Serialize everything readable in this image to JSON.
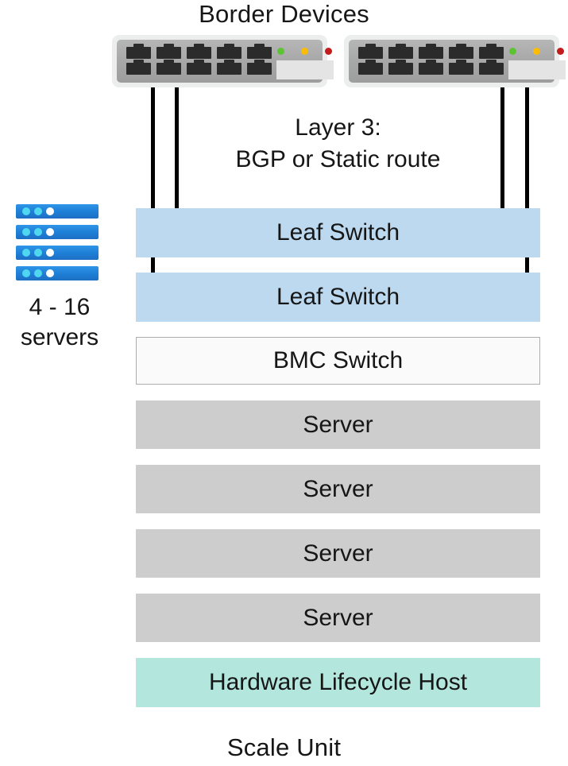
{
  "title": "Border Devices",
  "bottom_label": "Scale Unit",
  "layer3_note": {
    "line1": "Layer 3:",
    "line2": "BGP or Static route"
  },
  "border_devices": [
    {
      "name": "border-device-1",
      "port_count": 10,
      "leds": [
        "green",
        "amber",
        "red"
      ]
    },
    {
      "name": "border-device-2",
      "port_count": 10,
      "leds": [
        "green",
        "amber",
        "red"
      ]
    }
  ],
  "server_stack": {
    "bar_count": 4,
    "count_line1": "4 - 16",
    "count_line2": "servers"
  },
  "rack_rows": [
    {
      "label": "Leaf Switch",
      "kind": "leaf"
    },
    {
      "label": "Leaf Switch",
      "kind": "leaf"
    },
    {
      "label": "BMC Switch",
      "kind": "bmc"
    },
    {
      "label": "Server",
      "kind": "server"
    },
    {
      "label": "Server",
      "kind": "server"
    },
    {
      "label": "Server",
      "kind": "server"
    },
    {
      "label": "Server",
      "kind": "server"
    },
    {
      "label": "Hardware Lifecycle Host",
      "kind": "hlh"
    }
  ],
  "colors": {
    "leaf": "#bcd9ef",
    "bmc": "#fafafa",
    "bmc_border": "#adadad",
    "server": "#cdcdcd",
    "hardware_lifecycle_host": "#b3e6dc",
    "server_icon": "#1e7fd6",
    "led_green": "#5cc433",
    "led_amber": "#fcbc04",
    "led_red": "#c41b1b",
    "cable": "#000000"
  }
}
